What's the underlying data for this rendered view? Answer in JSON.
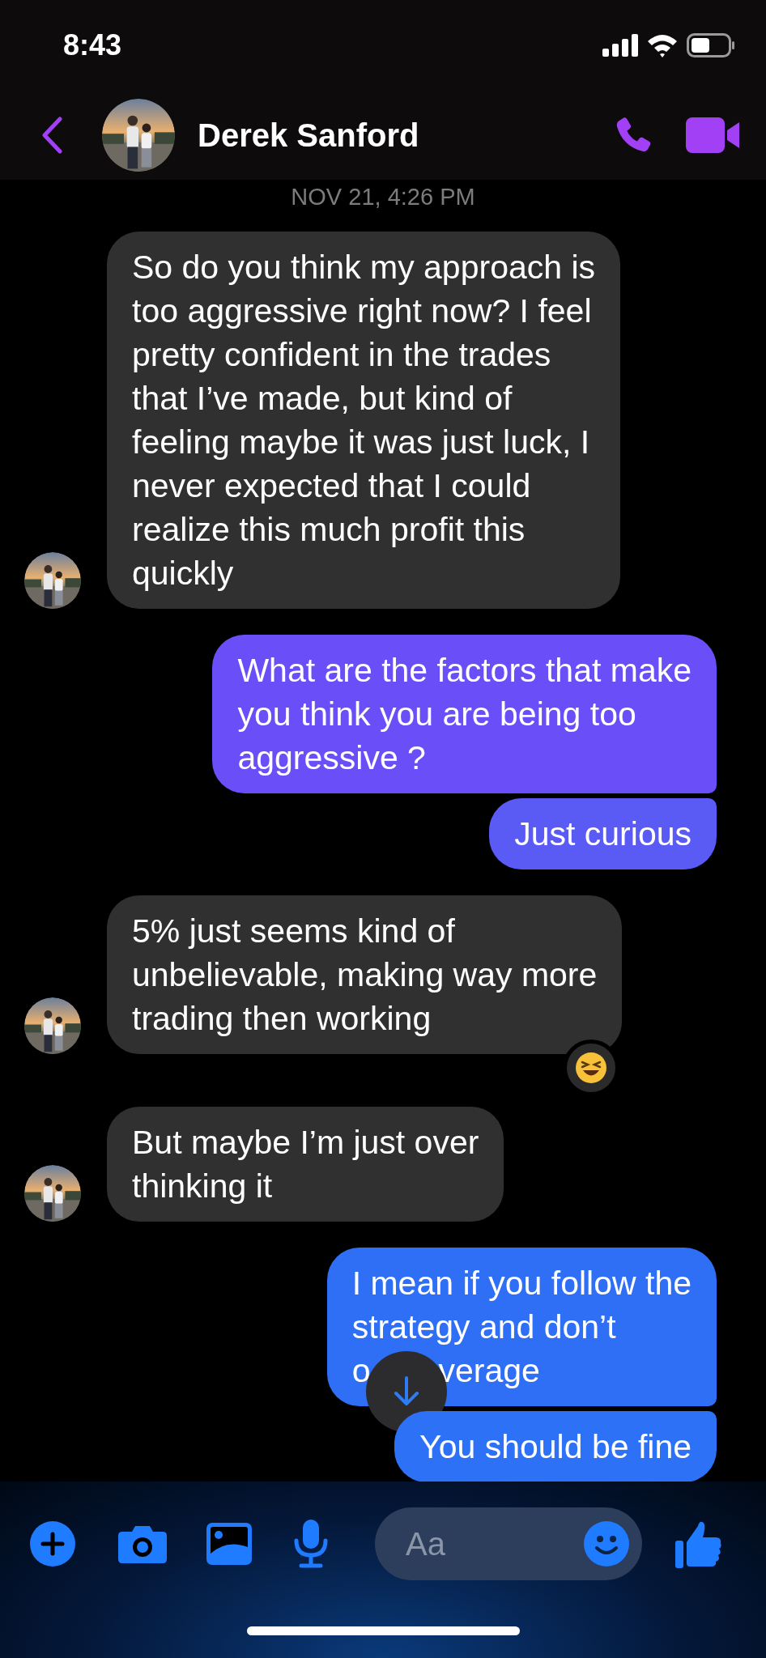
{
  "status_bar": {
    "time": "8:43"
  },
  "header": {
    "contact_name": "Derek Sanford"
  },
  "timestamp": "NOV 21, 4:26 PM",
  "messages": [
    {
      "kind": "incoming",
      "lines": [
        [
          "So do you think my approach is"
        ],
        [
          "too aggressive right now? I feel"
        ],
        [
          "pretty confident in the trades"
        ],
        [
          "that I’ve made, but kind of"
        ],
        [
          "feeling maybe it was just luck, I"
        ],
        [
          "never expected that I could"
        ],
        [
          "realize this much profit this"
        ],
        [
          "quickly"
        ]
      ],
      "show_avatar": true,
      "reacted": false
    },
    {
      "kind": "outgoing",
      "lines": [
        [
          "What are the factors that make"
        ],
        [
          "you think you are being too"
        ],
        [
          "aggressive ?"
        ]
      ],
      "color": "#6a4ef7",
      "reacted": false
    },
    {
      "kind": "outgoing",
      "lines": [
        [
          "Just curious"
        ]
      ],
      "color": "#5a5af5",
      "reacted": false
    },
    {
      "kind": "incoming",
      "lines": [
        [
          "5% just seems kind of"
        ],
        [
          "unbelievable, making way more"
        ],
        [
          "trading then working"
        ]
      ],
      "show_avatar": true,
      "reacted": true
    },
    {
      "kind": "incoming",
      "lines": [
        [
          "But maybe I’m just over"
        ],
        [
          "thinking it"
        ]
      ],
      "show_avatar": true,
      "reacted": false
    },
    {
      "kind": "outgoing",
      "lines": [
        [
          "I mean if you follow the"
        ],
        [
          "strategy and don’t"
        ],
        [
          "o",
          "verage"
        ]
      ],
      "color": "#2f6ff6",
      "reacted": false,
      "scroll_button": true
    },
    {
      "kind": "outgoing",
      "lines": [
        [
          "You should be fine"
        ]
      ],
      "color": "#2d72f6",
      "reacted": false
    }
  ],
  "composer": {
    "placeholder": "Aa"
  }
}
